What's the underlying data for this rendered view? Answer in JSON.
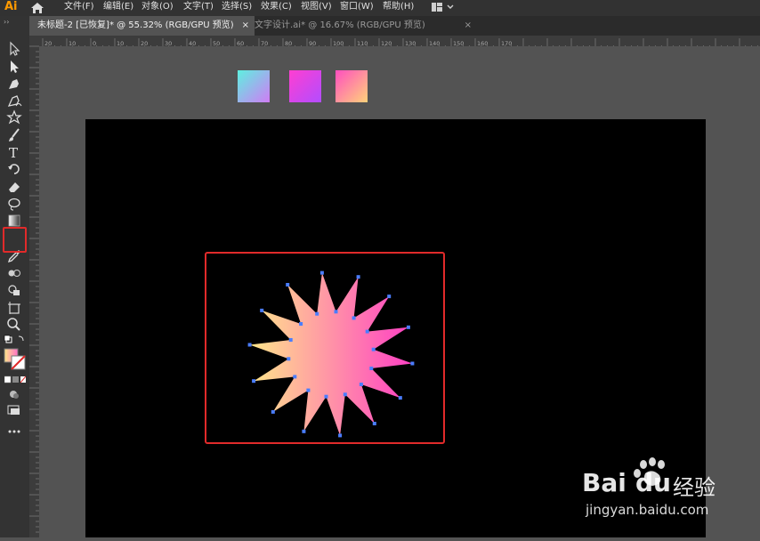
{
  "app": {
    "logo": "Ai"
  },
  "menu": [
    "文件(F)",
    "编辑(E)",
    "对象(O)",
    "文字(T)",
    "选择(S)",
    "效果(C)",
    "视图(V)",
    "窗口(W)",
    "帮助(H)"
  ],
  "tabs": [
    {
      "label": "未标题-2 [已恢复]* @ 55.32% (RGB/GPU 预览)",
      "close": "×"
    },
    {
      "label": "文字设计.ai* @ 16.67% (RGB/GPU 预览)",
      "close": "×"
    }
  ],
  "ruler": {
    "h_ticks": [
      "20",
      "10",
      "0",
      "10",
      "20",
      "30",
      "40",
      "50",
      "60",
      "70",
      "80",
      "90",
      "100",
      "110",
      "120",
      "130",
      "140",
      "150",
      "160",
      "170"
    ]
  },
  "swatches": [
    {
      "from": "#5ef0e0",
      "to": "#d07cf5"
    },
    {
      "from": "#ff3ed1",
      "to": "#b24dff"
    },
    {
      "from": "#ff4fbf",
      "to": "#ffd27a"
    }
  ],
  "star_gradient": {
    "from": "#ffe68a",
    "to": "#ff3fc4"
  },
  "accent": {
    "selection": "#e12a2a",
    "anchor": "#4a7dff"
  },
  "icons": [
    "selection-icon",
    "direct-selection-icon",
    "pen-icon",
    "curvature-icon",
    "star-icon",
    "paintbrush-icon",
    "type-icon",
    "rotate-icon",
    "eraser-icon",
    "lasso-icon",
    "gradient-icon",
    "eyedropper-icon",
    "blend-icon",
    "shape-builder-icon",
    "artboard-icon",
    "zoom-icon",
    "fill-stroke-icon",
    "more-tools-icon"
  ],
  "watermark": {
    "brand": "Bai",
    "brand2": "du",
    "label": "经验",
    "url": "jingyan.baidu.com"
  }
}
